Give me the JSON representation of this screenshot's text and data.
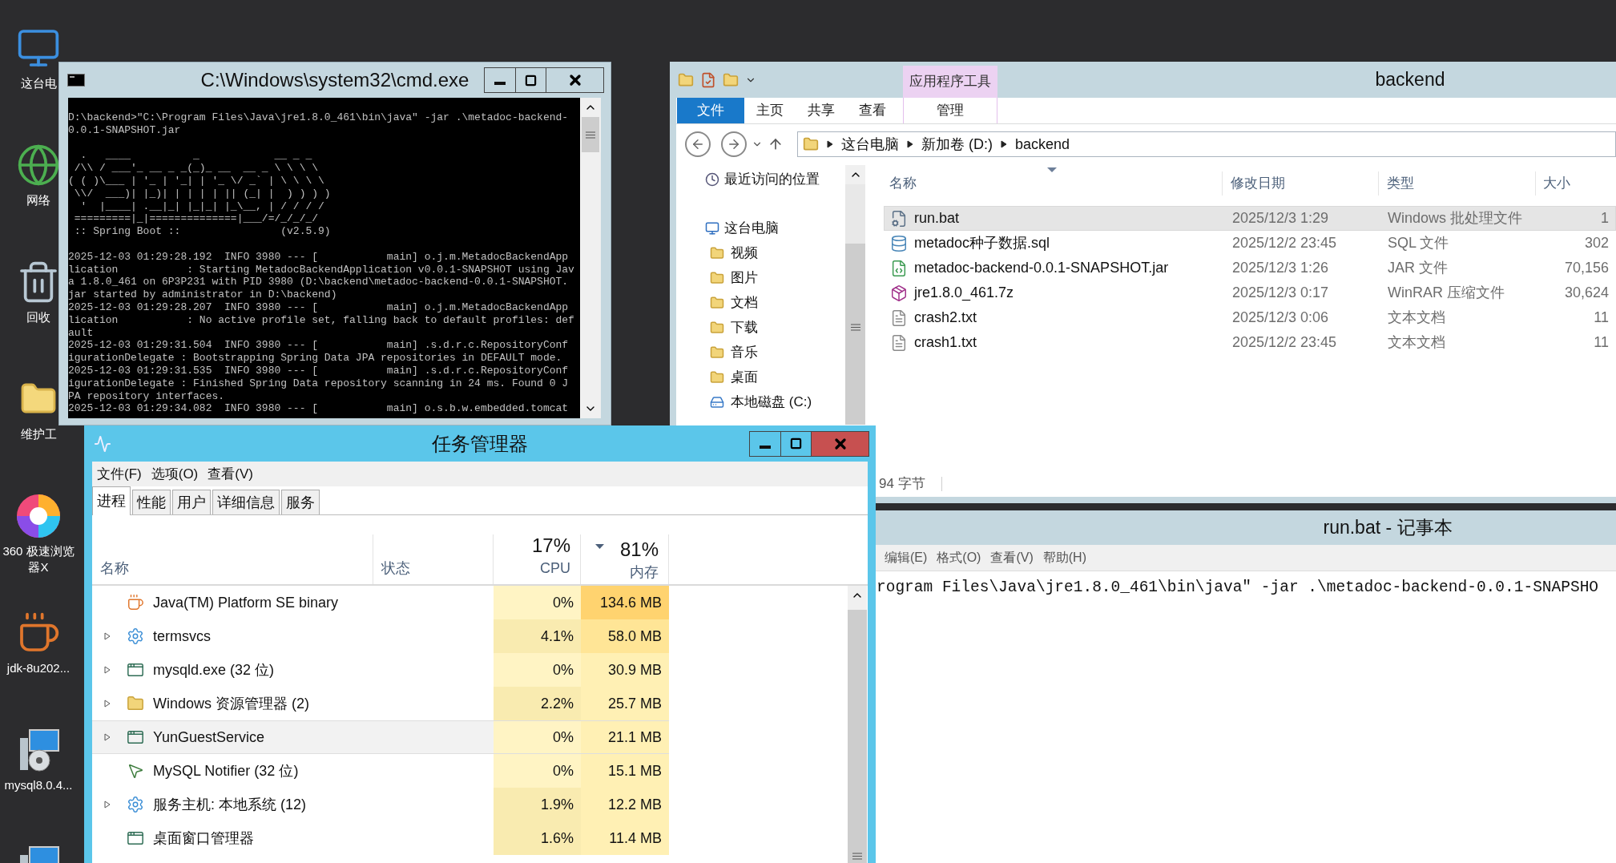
{
  "desktop": {
    "icons": [
      {
        "label": "这台电"
      },
      {
        "label": "网络"
      },
      {
        "label": "回收"
      },
      {
        "label": "维护工"
      },
      {
        "label": "360 极速浏览器X"
      },
      {
        "label": "jdk-8u202..."
      },
      {
        "label": "mysql8.0.4..."
      }
    ]
  },
  "cmd_window": {
    "title": "C:\\Windows\\system32\\cmd.exe",
    "console": [
      [
        "D:\\backend>\"C:\\Program Files\\Java\\jre1.8.0_461\\bin\\java\" -jar .\\metadoc-backend-",
        "0.0.1-SNAPSHOT.jar"
      ],
      [
        "  .   ____          _            __ _ _",
        " /\\\\ / ___'_ __ _ _(_)_ __  __ _ \\ \\ \\ \\",
        "( ( )\\___ | '_ | '_| | '_ \\/ _` | \\ \\ \\ \\",
        " \\\\/  ___)| |_)| | | | | || (_| |  ) ) ) )",
        "  '  |____| .__|_| |_|_| |_\\__, | / / / /",
        " =========|_|==============|___/=/_/_/_/",
        " :: Spring Boot ::                (v2.5.9)"
      ],
      [
        "2025-12-03 01:29:28.192  INFO 3980 --- [           main] o.j.m.MetadocBackendApp",
        "lication           : Starting MetadocBackendApplication v0.0.1-SNAPSHOT using Jav",
        "a 1.8.0_461 on 6P3P231 with PID 3980 (D:\\backend\\metadoc-backend-0.0.1-SNAPSHOT.",
        "jar started by administrator in D:\\backend)",
        "2025-12-03 01:29:28.207  INFO 3980 --- [           main] o.j.m.MetadocBackendApp",
        "lication           : No active profile set, falling back to default profiles: def",
        "ault",
        "2025-12-03 01:29:31.504  INFO 3980 --- [           main] .s.d.r.c.RepositoryConf",
        "igurationDelegate : Bootstrapping Spring Data JPA repositories in DEFAULT mode.",
        "2025-12-03 01:29:31.535  INFO 3980 --- [           main] .s.d.r.c.RepositoryConf",
        "igurationDelegate : Finished Spring Data repository scanning in 24 ms. Found 0 J",
        "PA repository interfaces.",
        "2025-12-03 01:29:34.082  INFO 3980 --- [           main] o.s.b.w.embedded.tomcat"
      ]
    ]
  },
  "explorer": {
    "context_tab": "应用程序工具",
    "title": "backend",
    "ribbon_tabs": [
      {
        "label": "文件",
        "kind": "file"
      },
      {
        "label": "主页",
        "kind": "tab"
      },
      {
        "label": "共享",
        "kind": "tab"
      },
      {
        "label": "查看",
        "kind": "tab"
      },
      {
        "label": "管理",
        "kind": "context"
      }
    ],
    "breadcrumb": [
      "这台电脑",
      "新加卷 (D:)",
      "backend"
    ],
    "nav": [
      {
        "label": "最近访问的位置"
      },
      {
        "label": "这台电脑",
        "children": [
          {
            "label": "视频"
          },
          {
            "label": "图片"
          },
          {
            "label": "文档"
          },
          {
            "label": "下载"
          },
          {
            "label": "音乐"
          },
          {
            "label": "桌面"
          },
          {
            "label": "本地磁盘 (C:)"
          }
        ]
      }
    ],
    "columns": [
      "名称",
      "修改日期",
      "类型",
      "大小"
    ],
    "files": [
      {
        "name": "run.bat",
        "modified": "2025/12/3 1:29",
        "type": "Windows 批处理文件",
        "size": "1",
        "selected": true
      },
      {
        "name": "metadoc种子数据.sql",
        "modified": "2025/12/2 23:45",
        "type": "SQL 文件",
        "size": "302",
        "selected": false
      },
      {
        "name": "metadoc-backend-0.0.1-SNAPSHOT.jar",
        "modified": "2025/12/3 1:26",
        "type": "JAR 文件",
        "size": "70,156",
        "selected": false
      },
      {
        "name": "jre1.8.0_461.7z",
        "modified": "2025/12/3 0:17",
        "type": "WinRAR 压缩文件",
        "size": "30,624",
        "selected": false
      },
      {
        "name": "crash2.txt",
        "modified": "2025/12/3 0:06",
        "type": "文本文档",
        "size": "11",
        "selected": false
      },
      {
        "name": "crash1.txt",
        "modified": "2025/12/2 23:45",
        "type": "文本文档",
        "size": "11",
        "selected": false
      }
    ],
    "status": "94 字节"
  },
  "notepad": {
    "title": "run.bat - 记事本",
    "menu": [
      "编辑(E)",
      "格式(O)",
      "查看(V)",
      "帮助(H)"
    ],
    "content": "rogram Files\\Java\\jre1.8.0_461\\bin\\java\" -jar .\\metadoc-backend-0.0.1-SNAPSHO"
  },
  "task_manager": {
    "title": "任务管理器",
    "menu": [
      "文件(F)",
      "选项(O)",
      "查看(V)"
    ],
    "tabs": [
      {
        "label": "进程",
        "selected": true
      },
      {
        "label": "性能",
        "selected": false
      },
      {
        "label": "用户",
        "selected": false
      },
      {
        "label": "详细信息",
        "selected": false
      },
      {
        "label": "服务",
        "selected": false
      }
    ],
    "columns": {
      "name": "名称",
      "status": "状态",
      "cpu_total": "17%",
      "cpu": "CPU",
      "memory_total": "81%",
      "memory": "内存"
    },
    "rows": [
      {
        "name": "Java(TM) Platform SE binary",
        "expandable": false,
        "selected": false,
        "cpu": {
          "text": "0%",
          "color": "#fff4c4"
        },
        "memory": {
          "text": "134.6 MB",
          "color": "#ffd36f"
        }
      },
      {
        "name": "termsvcs",
        "expandable": true,
        "selected": false,
        "cpu": {
          "text": "4.1%",
          "color": "#f9ebb0"
        },
        "memory": {
          "text": "58.0 MB",
          "color": "#ffe596"
        }
      },
      {
        "name": "mysqld.exe (32 位)",
        "expandable": true,
        "selected": false,
        "cpu": {
          "text": "0%",
          "color": "#fff4c4"
        },
        "memory": {
          "text": "30.9 MB",
          "color": "#fff0b4"
        }
      },
      {
        "name": "Windows 资源管理器 (2)",
        "expandable": true,
        "selected": false,
        "cpu": {
          "text": "2.2%",
          "color": "#f9ebb0"
        },
        "memory": {
          "text": "25.7 MB",
          "color": "#fff0b4"
        }
      },
      {
        "name": "YunGuestService",
        "expandable": true,
        "selected": true,
        "cpu": {
          "text": "0%",
          "color": "#fff4c4"
        },
        "memory": {
          "text": "21.1 MB",
          "color": "#fff0b4"
        }
      },
      {
        "name": "MySQL Notifier (32 位)",
        "expandable": false,
        "selected": false,
        "cpu": {
          "text": "0%",
          "color": "#fff4c4"
        },
        "memory": {
          "text": "15.1 MB",
          "color": "#fff0b4"
        }
      },
      {
        "name": "服务主机: 本地系统 (12)",
        "expandable": true,
        "selected": false,
        "cpu": {
          "text": "1.9%",
          "color": "#f9ebb0"
        },
        "memory": {
          "text": "12.2 MB",
          "color": "#fff0b4"
        }
      },
      {
        "name": "桌面窗口管理器",
        "expandable": false,
        "selected": false,
        "cpu": {
          "text": "1.6%",
          "color": "#f9ebb0"
        },
        "memory": {
          "text": "11.4 MB",
          "color": "#fff0b4"
        }
      }
    ]
  }
}
